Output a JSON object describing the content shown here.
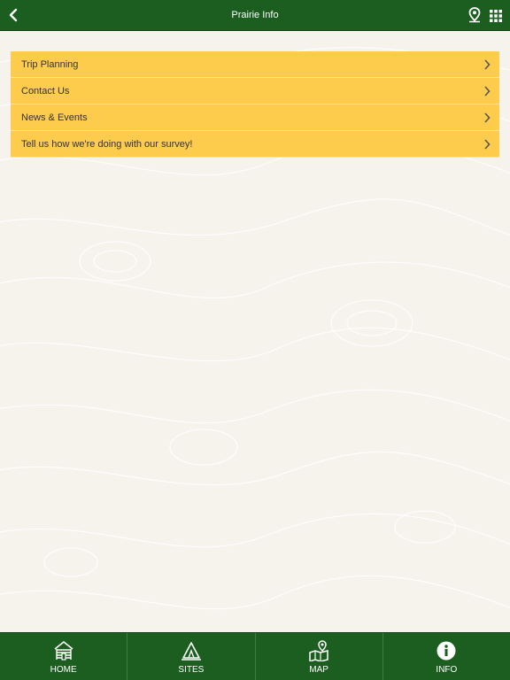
{
  "header": {
    "title": "Prairie Info",
    "back_icon": "chevron-left-icon",
    "pin_icon": "map-pin-icon",
    "grid_icon": "grid-menu-icon"
  },
  "menu": {
    "items": [
      {
        "label": "Trip Planning"
      },
      {
        "label": "Contact Us"
      },
      {
        "label": "News & Events"
      },
      {
        "label": "Tell us how we're doing with our survey!"
      }
    ]
  },
  "tabbar": {
    "tabs": [
      {
        "label": "HOME",
        "icon": "home-icon"
      },
      {
        "label": "SITES",
        "icon": "tent-icon"
      },
      {
        "label": "MAP",
        "icon": "map-icon"
      },
      {
        "label": "INFO",
        "icon": "info-icon"
      }
    ]
  },
  "colors": {
    "brand_green": "#1c5e20",
    "menu_yellow": "#fecc4d",
    "background": "#f6f2ec"
  }
}
